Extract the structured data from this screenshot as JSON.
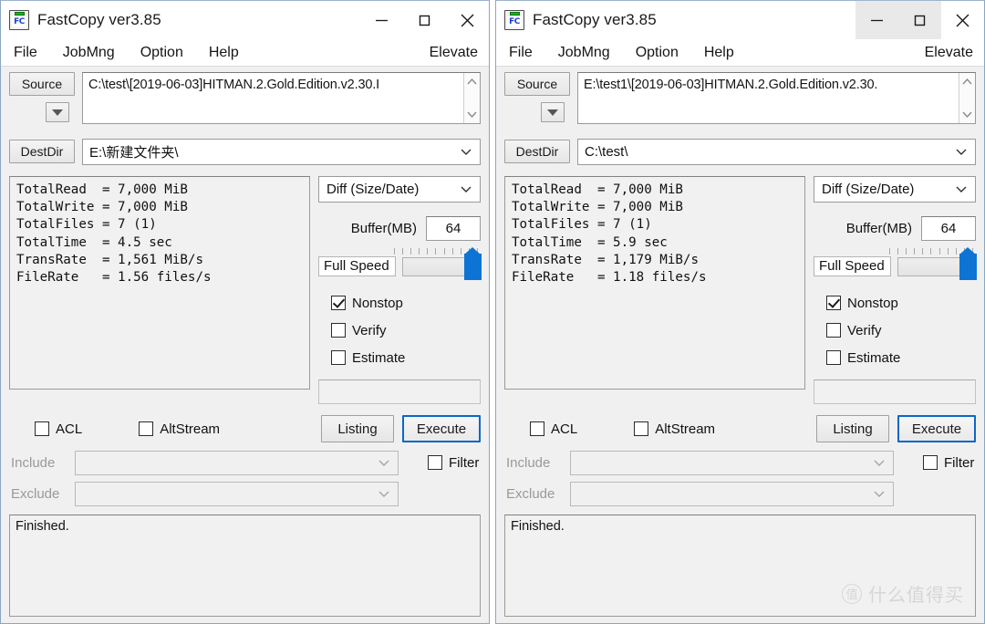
{
  "app": {
    "icon_name": "fastcopy-icon",
    "icon_text": "FC"
  },
  "windows": [
    {
      "id": "left",
      "title": "FastCopy ver3.85",
      "titlebar_buttons": {
        "minimize": "minimize-icon",
        "maximize": "maximize-icon",
        "close": "close-icon",
        "minimize_hover": false,
        "maximize_hover": false
      },
      "menu": {
        "items": [
          "File",
          "JobMng",
          "Option",
          "Help"
        ],
        "right_item": "Elevate"
      },
      "source": {
        "button_label": "Source",
        "value": "C:\\test\\[2019-06-03]HITMAN.2.Gold.Edition.v2.30.I",
        "dropdown_icon": "triangle-down-icon",
        "scroll_up_icon": "chevron-up-icon",
        "scroll_down_icon": "chevron-down-icon"
      },
      "dest": {
        "button_label": "DestDir",
        "value": "E:\\新建文件夹\\",
        "chevron_icon": "chevron-down-icon"
      },
      "stats": {
        "lines": [
          "TotalRead  = 7,000 MiB",
          "TotalWrite = 7,000 MiB",
          "TotalFiles = 7 (1)",
          "TotalTime  = 4.5 sec",
          "TransRate  = 1,561 MiB/s",
          "FileRate   = 1.56 files/s"
        ],
        "TotalRead": "7,000 MiB",
        "TotalWrite": "7,000 MiB",
        "TotalFiles": "7 (1)",
        "TotalTime": "4.5 sec",
        "TransRate": "1,561 MiB/s",
        "FileRate": "1.56 files/s"
      },
      "mode": {
        "selected": "Diff (Size/Date)",
        "chevron_icon": "chevron-down-icon"
      },
      "buffer": {
        "label": "Buffer(MB)",
        "value": "64"
      },
      "speed": {
        "label": "Full Speed",
        "thumb_position_percent": 100,
        "tick_count": 11
      },
      "checkboxes": [
        {
          "label": "Nonstop",
          "checked": true
        },
        {
          "label": "Verify",
          "checked": false
        },
        {
          "label": "Estimate",
          "checked": false
        }
      ],
      "memo": {
        "value": ""
      },
      "actions": {
        "acl": {
          "label": "ACL",
          "checked": false
        },
        "altstream": {
          "label": "AltStream",
          "checked": false
        },
        "listing_label": "Listing",
        "execute_label": "Execute"
      },
      "filters": {
        "include": {
          "label": "Include",
          "value": "",
          "chevron_icon": "chevron-down-icon"
        },
        "exclude": {
          "label": "Exclude",
          "value": "",
          "chevron_icon": "chevron-down-icon"
        },
        "filter_checkbox": {
          "label": "Filter",
          "checked": false
        }
      },
      "log": {
        "text": "Finished."
      }
    },
    {
      "id": "right",
      "title": "FastCopy ver3.85",
      "titlebar_buttons": {
        "minimize": "minimize-icon",
        "maximize": "maximize-icon",
        "close": "close-icon",
        "minimize_hover": true,
        "maximize_hover": true
      },
      "menu": {
        "items": [
          "File",
          "JobMng",
          "Option",
          "Help"
        ],
        "right_item": "Elevate"
      },
      "source": {
        "button_label": "Source",
        "value": "E:\\test1\\[2019-06-03]HITMAN.2.Gold.Edition.v2.30.",
        "dropdown_icon": "triangle-down-icon",
        "scroll_up_icon": "chevron-up-icon",
        "scroll_down_icon": "chevron-down-icon"
      },
      "dest": {
        "button_label": "DestDir",
        "value": "C:\\test\\",
        "chevron_icon": "chevron-down-icon"
      },
      "stats": {
        "lines": [
          "TotalRead  = 7,000 MiB",
          "TotalWrite = 7,000 MiB",
          "TotalFiles = 7 (1)",
          "TotalTime  = 5.9 sec",
          "TransRate  = 1,179 MiB/s",
          "FileRate   = 1.18 files/s"
        ],
        "TotalRead": "7,000 MiB",
        "TotalWrite": "7,000 MiB",
        "TotalFiles": "7 (1)",
        "TotalTime": "5.9 sec",
        "TransRate": "1,179 MiB/s",
        "FileRate": "1.18 files/s"
      },
      "mode": {
        "selected": "Diff (Size/Date)",
        "chevron_icon": "chevron-down-icon"
      },
      "buffer": {
        "label": "Buffer(MB)",
        "value": "64"
      },
      "speed": {
        "label": "Full Speed",
        "thumb_position_percent": 100,
        "tick_count": 11
      },
      "checkboxes": [
        {
          "label": "Nonstop",
          "checked": true
        },
        {
          "label": "Verify",
          "checked": false
        },
        {
          "label": "Estimate",
          "checked": false
        }
      ],
      "memo": {
        "value": ""
      },
      "actions": {
        "acl": {
          "label": "ACL",
          "checked": false
        },
        "altstream": {
          "label": "AltStream",
          "checked": false
        },
        "listing_label": "Listing",
        "execute_label": "Execute"
      },
      "filters": {
        "include": {
          "label": "Include",
          "value": "",
          "chevron_icon": "chevron-down-icon"
        },
        "exclude": {
          "label": "Exclude",
          "value": "",
          "chevron_icon": "chevron-down-icon"
        },
        "filter_checkbox": {
          "label": "Filter",
          "checked": false
        }
      },
      "log": {
        "text": "Finished."
      }
    }
  ],
  "watermark": {
    "logo_char": "值",
    "text": "什么值得买"
  },
  "colors": {
    "accent_blue": "#0d74d4",
    "focus_blue": "#0a67c8",
    "window_border": "#8ba7c4",
    "panel_bg": "#f0f0f0"
  }
}
